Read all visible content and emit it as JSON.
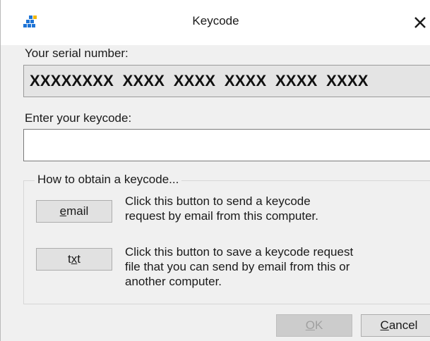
{
  "window": {
    "title": "Keycode",
    "close_glyph": "✕"
  },
  "serial": {
    "label": "Your serial number:",
    "value": "XXXXXXXX  XXXX  XXXX  XXXX  XXXX  XXXX"
  },
  "keycode": {
    "label": "Enter your keycode:",
    "value": ""
  },
  "obtain_group": {
    "legend": "How to obtain a keycode...",
    "email_button": {
      "mnemonic": "e",
      "rest": "mail"
    },
    "email_description_lines": [
      "Click this button to send a keycode",
      "request by email from this computer."
    ],
    "txt_button": {
      "pre": "t",
      "mnemonic": "x",
      "rest": "t"
    },
    "txt_description_lines": [
      "Click this button to save a keycode request",
      "file that you can send by email from this or",
      "another computer."
    ]
  },
  "footer": {
    "ok_button": {
      "mnemonic": "O",
      "rest": "K",
      "enabled": false
    },
    "cancel_button": {
      "mnemonic": "C",
      "rest": "ancel",
      "enabled": true
    }
  },
  "icons": {
    "app": "grid-tiles-icon",
    "close": "close-icon"
  },
  "colors": {
    "app_icon_blue": "#1e74d6",
    "app_icon_yellow": "#f2b705",
    "dialog_background": "#f0f0f0",
    "serial_background": "#e4e4e4"
  }
}
